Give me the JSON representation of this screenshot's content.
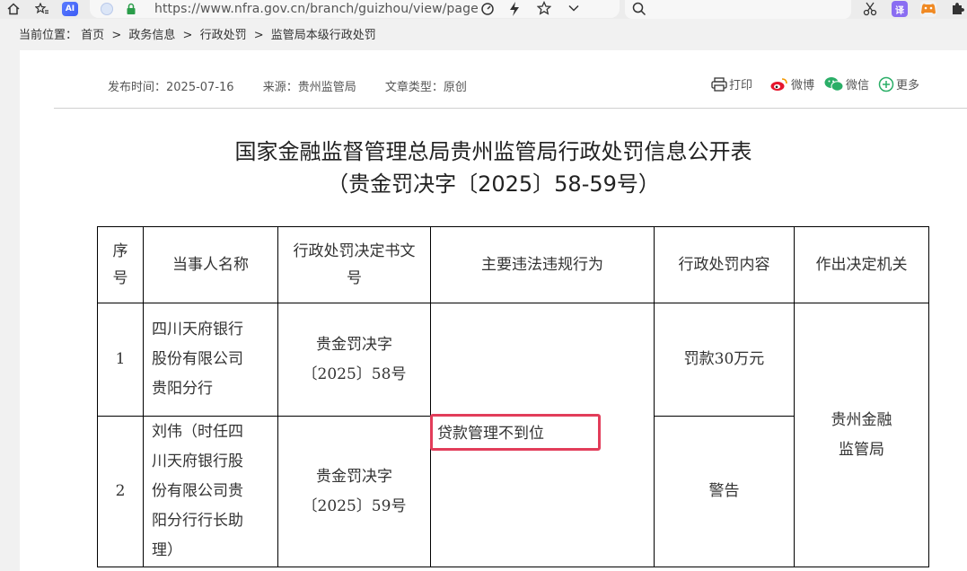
{
  "browser": {
    "url": "https://www.nfra.gov.cn/branch/guizhou/view/page",
    "ai_label": "AI",
    "translate_label": "译"
  },
  "breadcrumb": {
    "label": "当前位置：",
    "items": [
      "首页",
      "政务信息",
      "行政处罚",
      "监管局本级行政处罚"
    ],
    "separator": ">"
  },
  "meta": {
    "publish_time": "发布时间：2025-07-16",
    "source": "来源：贵州监管局",
    "article_type": "文章类型：原创"
  },
  "share": {
    "print": "打印",
    "weibo": "微博",
    "wechat": "微信",
    "more": "更多"
  },
  "title": {
    "line1": "国家金融监督管理总局贵州监管局行政处罚信息公开表",
    "line2": "（贵金罚决字〔2025〕58-59号）"
  },
  "table": {
    "headers": {
      "seq": "序号",
      "party": "当事人名称",
      "doc_no": "行政处罚决定书文号",
      "violation": "主要违法违规行为",
      "penalty": "行政处罚内容",
      "authority": "作出决定机关"
    },
    "rows": [
      {
        "seq": "1",
        "party_lines": [
          "四川天府银行",
          "股份有限公司",
          "贵阳分行"
        ],
        "doc_lines": [
          "贵金罚决字",
          "〔2025〕58号"
        ],
        "penalty": "罚款30万元"
      },
      {
        "seq": "2",
        "party_lines": [
          "刘伟（时任四",
          "川天府银行股",
          "份有限公司贵",
          "阳分行行长助",
          "理）"
        ],
        "doc_lines": [
          "贵金罚决字",
          "〔2025〕59号"
        ],
        "penalty": "警告"
      }
    ],
    "shared_violation": "贷款管理不到位",
    "shared_authority_lines": [
      "贵州金融",
      "监管局"
    ]
  },
  "colors": {
    "highlight_border": "#e23d5a",
    "weibo_red": "#e6162d",
    "wechat_green": "#2aae67"
  }
}
